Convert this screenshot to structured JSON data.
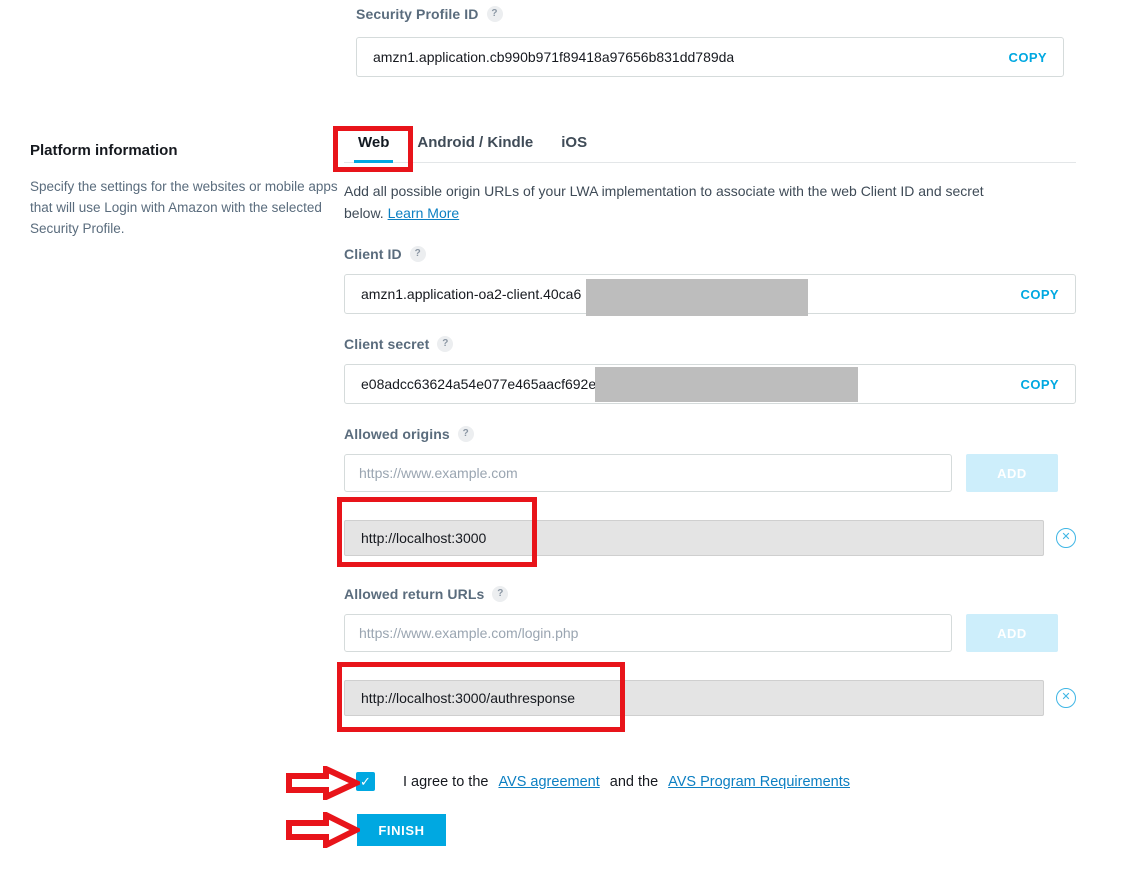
{
  "security_profile": {
    "label": "Security Profile ID",
    "help_icon": "question-mark-icon",
    "value": "amzn1.application.cb990b971f89418a97656b831dd789da",
    "copy_label": "COPY"
  },
  "sidebar": {
    "title": "Platform information",
    "description": "Specify the settings for the websites or mobile apps that will use Login with Amazon with the selected Security Profile."
  },
  "panel": {
    "tabs": [
      {
        "label": "Web",
        "active": true
      },
      {
        "label": "Android / Kindle",
        "active": false
      },
      {
        "label": "iOS",
        "active": false
      }
    ],
    "description": "Add all possible origin URLs of your LWA implementation to associate with the web Client ID and secret below.",
    "learn_more": "Learn More",
    "client_id": {
      "label": "Client ID",
      "help_icon": "question-mark-icon",
      "value": "amzn1.application-oa2-client.40ca6",
      "copy_label": "COPY",
      "redacted": true
    },
    "client_secret": {
      "label": "Client secret",
      "help_icon": "question-mark-icon",
      "value": "e08adcc63624a54e077e465aacf692e",
      "copy_label": "COPY",
      "redacted": true
    },
    "allowed_origins": {
      "label": "Allowed origins",
      "help_icon": "question-mark-icon",
      "placeholder": "https://www.example.com",
      "input_value": "",
      "add_label": "ADD",
      "entries": [
        {
          "value": "http://localhost:3000",
          "remove_icon": "circle-x-icon"
        }
      ]
    },
    "allowed_return_urls": {
      "label": "Allowed return URLs",
      "help_icon": "question-mark-icon",
      "placeholder": "https://www.example.com/login.php",
      "input_value": "",
      "add_label": "ADD",
      "entries": [
        {
          "value": "http://localhost:3000/authresponse",
          "remove_icon": "circle-x-icon"
        }
      ]
    }
  },
  "agreement": {
    "checked": true,
    "check_glyph": "✓",
    "prefix": "I agree to the",
    "link_one": "AVS agreement",
    "middle": "and the",
    "link_two": "AVS Program Requirements"
  },
  "finish_button": {
    "label": "FINISH"
  },
  "colors": {
    "accent": "#00a8e1",
    "accent_disabled": "#cdeefb",
    "link": "#0c7fc2",
    "annotation_red": "#e8141a",
    "redaction_gray": "#bdbdbd",
    "entry_gray": "#e4e4e4"
  }
}
